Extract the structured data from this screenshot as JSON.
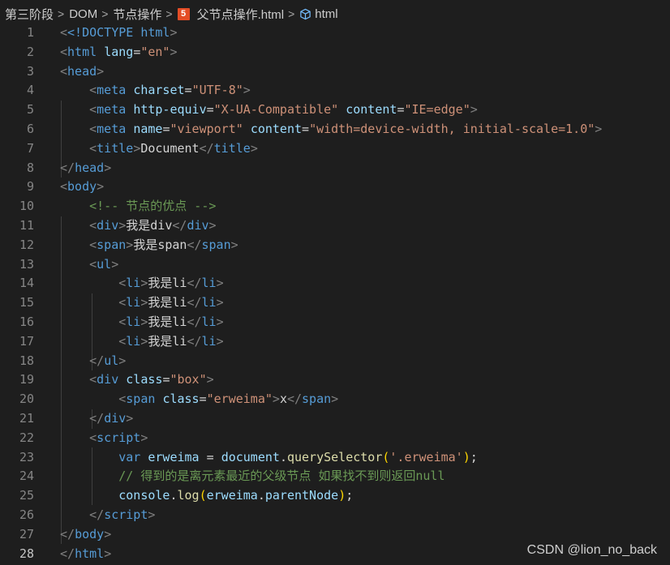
{
  "breadcrumb": {
    "items": [
      "第三阶段",
      "DOM",
      "节点操作",
      "父节点操作.html",
      "html"
    ],
    "separator": ">",
    "file_icon_letter": "5"
  },
  "editor": {
    "active_line": 28,
    "lines": [
      {
        "n": "1"
      },
      {
        "n": "2"
      },
      {
        "n": "3"
      },
      {
        "n": "4"
      },
      {
        "n": "5"
      },
      {
        "n": "6"
      },
      {
        "n": "7"
      },
      {
        "n": "8"
      },
      {
        "n": "9"
      },
      {
        "n": "10"
      },
      {
        "n": "11"
      },
      {
        "n": "12"
      },
      {
        "n": "13"
      },
      {
        "n": "14"
      },
      {
        "n": "15"
      },
      {
        "n": "16"
      },
      {
        "n": "17"
      },
      {
        "n": "18"
      },
      {
        "n": "19"
      },
      {
        "n": "20"
      },
      {
        "n": "21"
      },
      {
        "n": "22"
      },
      {
        "n": "23"
      },
      {
        "n": "24"
      },
      {
        "n": "25"
      },
      {
        "n": "26"
      },
      {
        "n": "27"
      },
      {
        "n": "28"
      }
    ],
    "code": {
      "l1": [
        "<!DOCTYPE",
        " html",
        ">"
      ],
      "l2": [
        "html",
        "lang",
        "\"en\""
      ],
      "l3": [
        "head"
      ],
      "l4": [
        "meta",
        "charset",
        "\"UTF-8\""
      ],
      "l5": [
        "meta",
        "http-equiv",
        "\"X-UA-Compatible\"",
        "content",
        "\"IE=edge\""
      ],
      "l6": [
        "meta",
        "name",
        "\"viewport\"",
        "content",
        "\"width=device-width, initial-scale=1.0\""
      ],
      "l7": [
        "title",
        "Document",
        "title"
      ],
      "l8": [
        "head"
      ],
      "l9": [
        "body"
      ],
      "l10": [
        "<!-- 节点的优点 -->"
      ],
      "l11": [
        "div",
        "我是div",
        "div"
      ],
      "l12": [
        "span",
        "我是span",
        "span"
      ],
      "l13": [
        "ul"
      ],
      "l14": [
        "li",
        "我是li",
        "li"
      ],
      "l15": [
        "li",
        "我是li",
        "li"
      ],
      "l16": [
        "li",
        "我是li",
        "li"
      ],
      "l17": [
        "li",
        "我是li",
        "li"
      ],
      "l18": [
        "ul"
      ],
      "l19": [
        "div",
        "class",
        "\"box\""
      ],
      "l20": [
        "span",
        "class",
        "\"erweima\"",
        "x",
        "span"
      ],
      "l21": [
        "div"
      ],
      "l22": [
        "script"
      ],
      "l23": [
        "var",
        "erweima",
        "=",
        "document",
        "querySelector",
        "'.erweima'"
      ],
      "l24": [
        "// 得到的是离元素最近的父级节点 如果找不到则返回null"
      ],
      "l25": [
        "console",
        "log",
        "erweima",
        "parentNode"
      ],
      "l26": [
        "script"
      ],
      "l27": [
        "body"
      ],
      "l28": [
        "html"
      ]
    }
  },
  "watermark": "CSDN @lion_no_back"
}
